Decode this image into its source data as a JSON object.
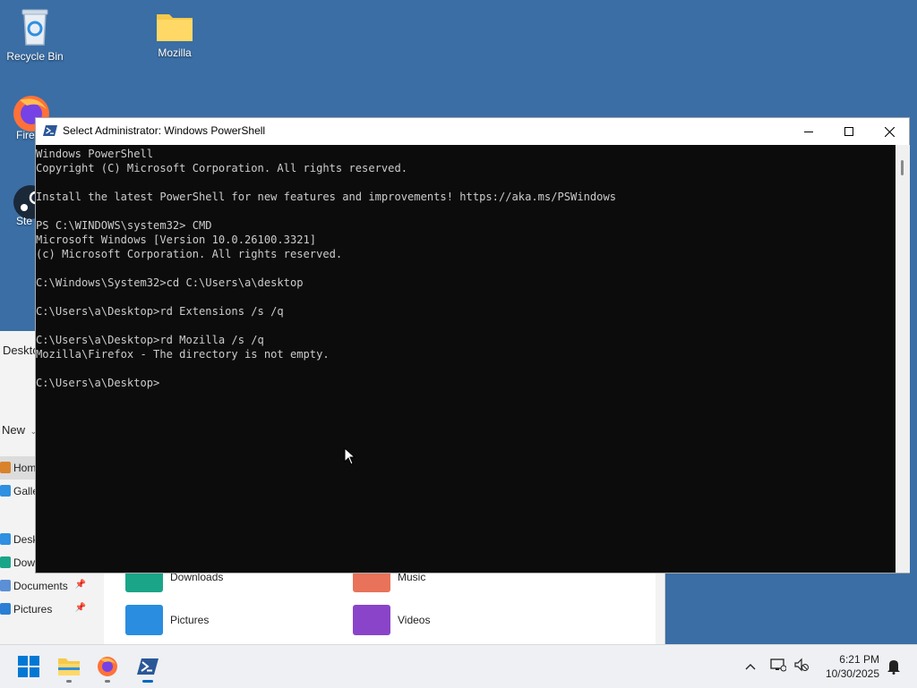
{
  "desktop": {
    "icons": [
      {
        "label": "Recycle Bin"
      },
      {
        "label": "Mozilla"
      },
      {
        "label": "Fire"
      },
      {
        "label": "Ste"
      }
    ]
  },
  "explorer": {
    "breadcrumb": "Deskto",
    "new_label": "New",
    "sidebar": [
      {
        "label": "Hom",
        "icon": "home-icon"
      },
      {
        "label": "Galle",
        "icon": "gallery-icon"
      },
      {
        "label": "Desk",
        "icon": "desktop-icon"
      },
      {
        "label": "Downloads",
        "icon": "downloads-icon"
      },
      {
        "label": "Documents",
        "icon": "documents-icon"
      },
      {
        "label": "Pictures",
        "icon": "pictures-icon"
      }
    ],
    "folders": [
      {
        "label": "Downloads"
      },
      {
        "label": "Music"
      },
      {
        "label": "Pictures"
      },
      {
        "label": "Videos"
      }
    ]
  },
  "powershell": {
    "title": "Select Administrator: Windows PowerShell",
    "console_lines": [
      "Windows PowerShell",
      "Copyright (C) Microsoft Corporation. All rights reserved.",
      "",
      "Install the latest PowerShell for new features and improvements! https://aka.ms/PSWindows",
      "",
      "PS C:\\WINDOWS\\system32> CMD",
      "Microsoft Windows [Version 10.0.26100.3321]",
      "(c) Microsoft Corporation. All rights reserved.",
      "",
      "C:\\Windows\\System32>cd C:\\Users\\a\\desktop",
      "",
      "C:\\Users\\a\\Desktop>rd Extensions /s /q",
      "",
      "C:\\Users\\a\\Desktop>rd Mozilla /s /q",
      "Mozilla\\Firefox - The directory is not empty.",
      "",
      "C:\\Users\\a\\Desktop>"
    ]
  },
  "taskbar": {
    "apps": [
      {
        "name": "start-button"
      },
      {
        "name": "file-explorer"
      },
      {
        "name": "firefox"
      },
      {
        "name": "powershell"
      }
    ],
    "clock": {
      "time": "6:21 PM",
      "date": "10/30/2025"
    }
  },
  "colors": {
    "desktop_bg": "#3a6ea5",
    "console_bg": "#0c0c0c",
    "console_text": "#cccccc",
    "accent": "#0067c0"
  }
}
